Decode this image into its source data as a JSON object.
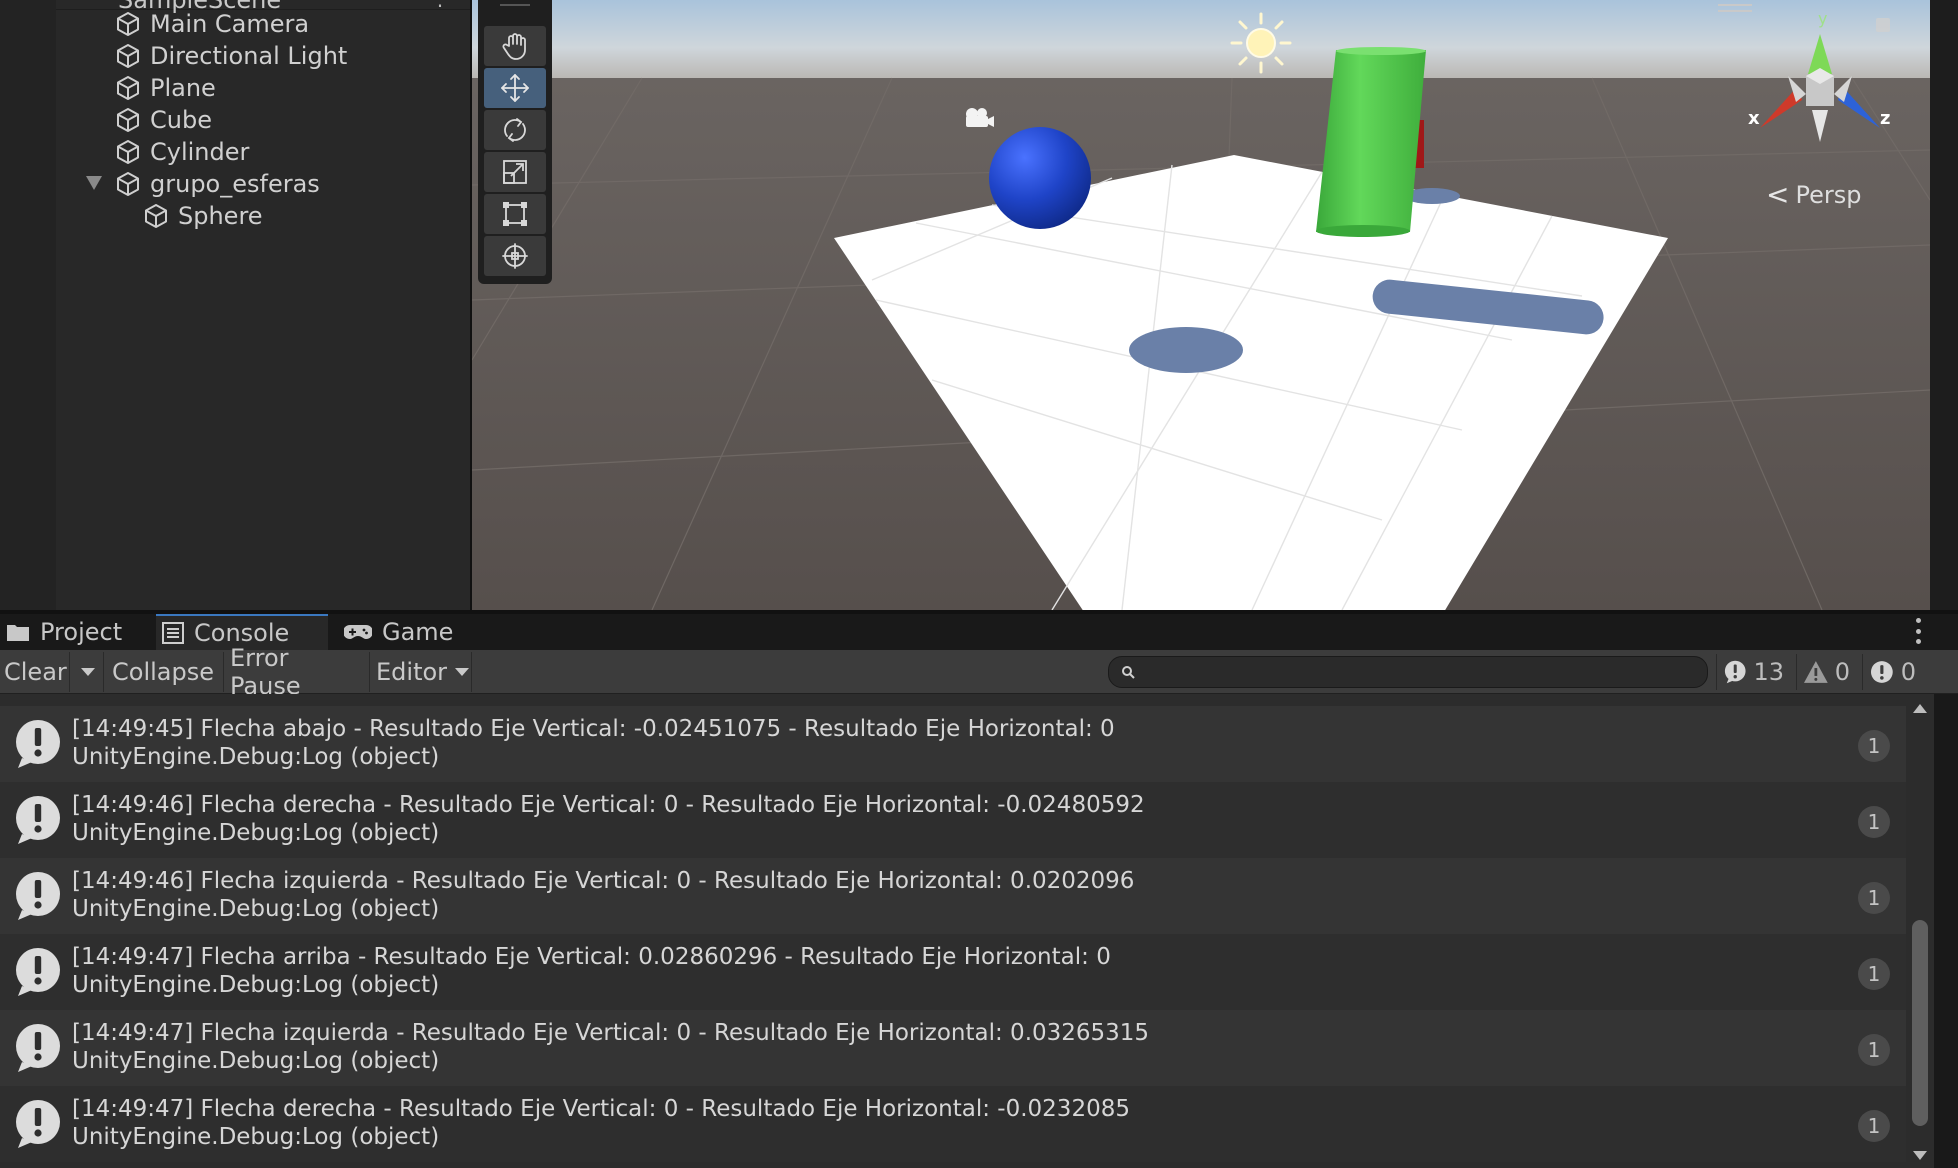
{
  "hierarchy": {
    "scene_name": "SampleScene",
    "items": [
      {
        "label": "Main Camera"
      },
      {
        "label": "Directional Light"
      },
      {
        "label": "Plane"
      },
      {
        "label": "Cube"
      },
      {
        "label": "Cylinder"
      },
      {
        "label": "grupo_esferas"
      },
      {
        "label": "Sphere"
      }
    ]
  },
  "scene_view": {
    "projection_label": "Persp",
    "gizmo_axes": {
      "x": "x",
      "y": "y",
      "z": "z"
    },
    "tools": [
      "hand-tool",
      "move-tool",
      "rotate-tool",
      "scale-tool",
      "rect-tool",
      "transform-tool"
    ],
    "active_tool": "move-tool"
  },
  "tabs": [
    {
      "label": "Project",
      "icon": "folder-icon"
    },
    {
      "label": "Console",
      "icon": "console-icon",
      "active": true
    },
    {
      "label": "Game",
      "icon": "gamepad-icon"
    }
  ],
  "console_toolbar": {
    "clear_label": "Clear",
    "collapse_label": "Collapse",
    "error_pause_label": "Error Pause",
    "editor_label": "Editor",
    "search_placeholder": "",
    "search_value": "",
    "log_count": "13",
    "warning_count": "0",
    "error_count": "0"
  },
  "logs": [
    {
      "line1": "[14:49:45] Flecha abajo - Resultado Eje Vertical: -0.02451075 - Resultado Eje Horizontal: 0",
      "line2": "UnityEngine.Debug:Log (object)",
      "count": "1"
    },
    {
      "line1": "[14:49:46] Flecha derecha - Resultado Eje Vertical: 0 - Resultado Eje Horizontal: -0.02480592",
      "line2": "UnityEngine.Debug:Log (object)",
      "count": "1"
    },
    {
      "line1": "[14:49:46] Flecha izquierda - Resultado Eje Vertical: 0 - Resultado Eje Horizontal: 0.0202096",
      "line2": "UnityEngine.Debug:Log (object)",
      "count": "1"
    },
    {
      "line1": "[14:49:47] Flecha arriba - Resultado Eje Vertical: 0.02860296 - Resultado Eje Horizontal: 0",
      "line2": "UnityEngine.Debug:Log (object)",
      "count": "1"
    },
    {
      "line1": "[14:49:47] Flecha izquierda - Resultado Eje Vertical: 0 - Resultado Eje Horizontal: 0.03265315",
      "line2": "UnityEngine.Debug:Log (object)",
      "count": "1"
    },
    {
      "line1": "[14:49:47] Flecha derecha - Resultado Eje Vertical: 0 - Resultado Eje Horizontal: -0.0232085",
      "line2": "UnityEngine.Debug:Log (object)",
      "count": "1"
    }
  ],
  "colors": {
    "accent": "#3a78c0",
    "sphere": "#1f44c8",
    "cylinder": "#4fc94a",
    "plane": "#ffffff",
    "shadow": "#6a80a8"
  }
}
